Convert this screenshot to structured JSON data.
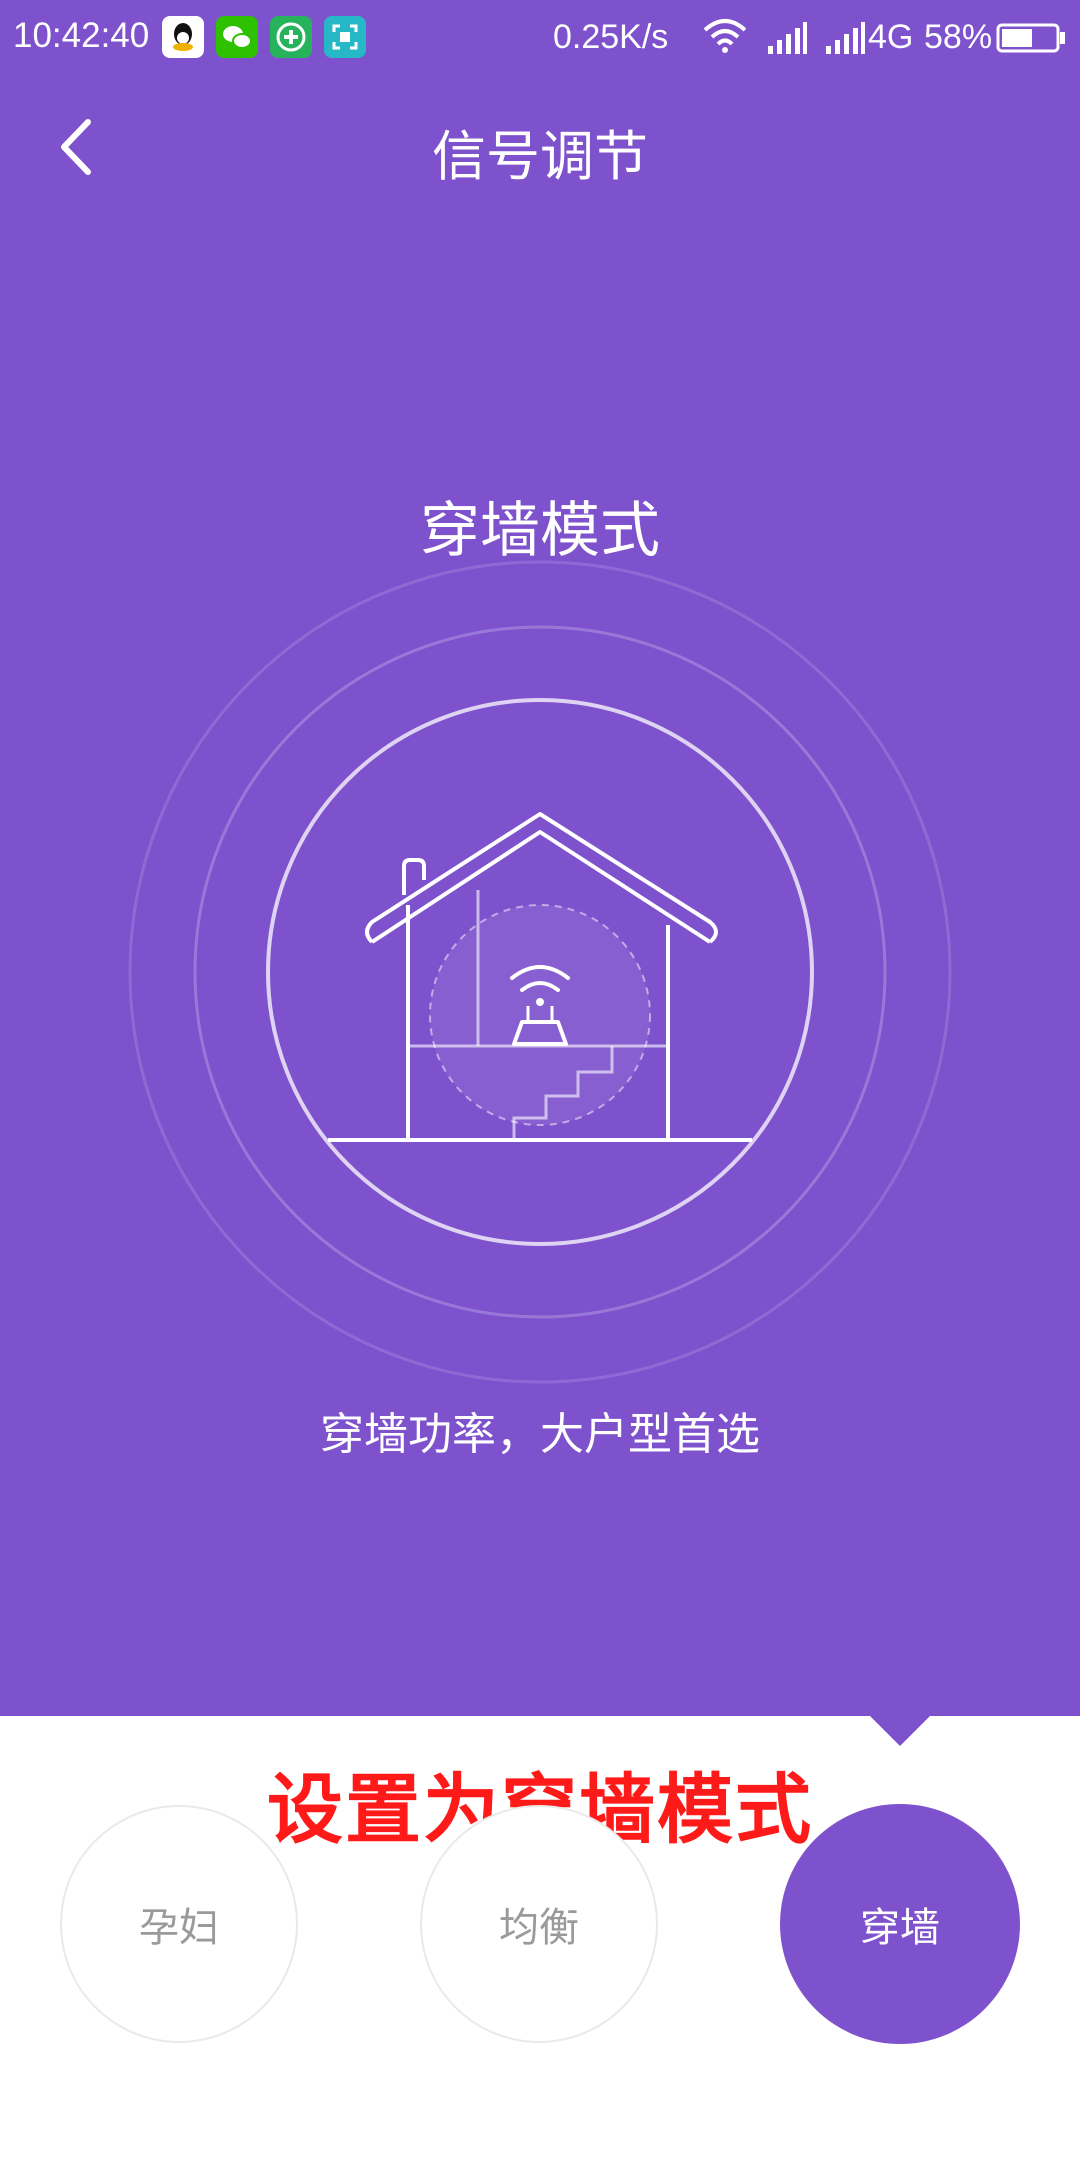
{
  "status_bar": {
    "time": "10:42:40",
    "net_speed": "0.25K/s",
    "network_type": "4G",
    "battery_percent": "58%",
    "battery_level": 0.58,
    "app_icons": [
      "qq-icon",
      "wechat-icon",
      "green-plus-app-icon",
      "scan-app-icon"
    ]
  },
  "header": {
    "title": "信号调节",
    "back_icon": "chevron-left-icon"
  },
  "mode_display": {
    "title": "穿墙模式",
    "description": "穿墙功率，大户型首选",
    "illustration": "house-router-icon"
  },
  "annotation": {
    "text": "设置为穿墙模式",
    "color": "#ff1a1a"
  },
  "modes": [
    {
      "label": "孕妇",
      "active": false
    },
    {
      "label": "均衡",
      "active": false
    },
    {
      "label": "穿墙",
      "active": true
    }
  ],
  "colors": {
    "primary": "#7e52cd",
    "inactive_text": "#9a9a9a"
  }
}
